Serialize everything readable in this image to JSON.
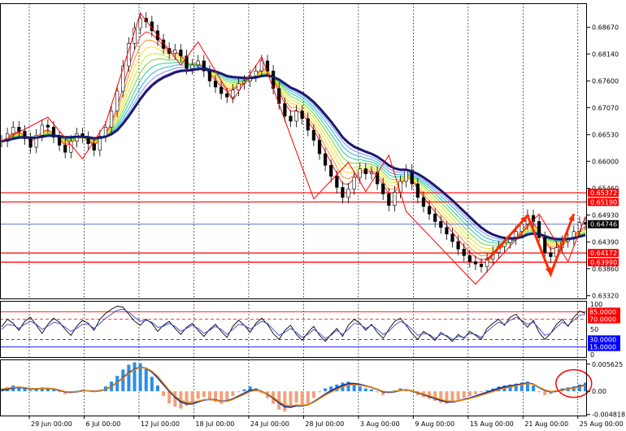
{
  "chart_data": [
    {
      "type": "line",
      "panel": "price",
      "x_labels": [
        "29 Jun 00:00",
        "6 Jul 00:00",
        "12 Jul 00:00",
        "18 Jul 00:00",
        "24 Jul 00:00",
        "28 Jul 00:00",
        "3 Aug 00:00",
        "9 Aug 00:00",
        "15 Aug 00:00",
        "21 Aug 00:00",
        "25 Aug 00:00"
      ],
      "y_ticks": [
        "0.68670",
        "0.68140",
        "0.67600",
        "0.67070",
        "0.66530",
        "0.66000",
        "0.65460",
        "0.64930",
        "0.64390",
        "0.63860",
        "0.63320"
      ],
      "ylim": [
        0.6325,
        0.6915
      ],
      "current_price": {
        "label": "0.64746",
        "value": 0.64746,
        "color": "#4a63c8"
      },
      "levels": [
        {
          "label": "0.65372",
          "value": 0.65372,
          "color": "#ff0000"
        },
        {
          "label": "0.65190",
          "value": 0.6519,
          "color": "#ff0000"
        },
        {
          "label": "0.64172",
          "value": 0.64172,
          "color": "#ff0000"
        },
        {
          "label": "0.63990",
          "value": 0.6399,
          "color": "#ff0000"
        }
      ],
      "close_series": [
        0.664,
        0.6655,
        0.6668,
        0.666,
        0.6645,
        0.6628,
        0.6652,
        0.6672,
        0.6668,
        0.6648,
        0.6632,
        0.6618,
        0.664,
        0.6655,
        0.6648,
        0.6635,
        0.6622,
        0.665,
        0.6668,
        0.67,
        0.674,
        0.679,
        0.6835,
        0.6865,
        0.6885,
        0.6878,
        0.686,
        0.6842,
        0.6825,
        0.6815,
        0.6822,
        0.681,
        0.6785,
        0.6792,
        0.68,
        0.678,
        0.676,
        0.6748,
        0.6735,
        0.6728,
        0.6742,
        0.6755,
        0.676,
        0.677,
        0.678,
        0.68,
        0.678,
        0.6745,
        0.6715,
        0.669,
        0.668,
        0.67,
        0.6685,
        0.6662,
        0.6642,
        0.6615,
        0.6592,
        0.657,
        0.6548,
        0.6528,
        0.6545,
        0.6568,
        0.6585,
        0.6575,
        0.6578,
        0.6555,
        0.6535,
        0.6512,
        0.6538,
        0.656,
        0.6582,
        0.6555,
        0.6528,
        0.651,
        0.6495,
        0.648,
        0.6468,
        0.6455,
        0.644,
        0.6425,
        0.6412,
        0.64,
        0.6395,
        0.639,
        0.6405,
        0.6418,
        0.643,
        0.6438,
        0.6445,
        0.646,
        0.6475,
        0.6492,
        0.648,
        0.6448,
        0.6418,
        0.641,
        0.6428,
        0.644,
        0.6445,
        0.646,
        0.6478,
        0.6475
      ],
      "ma_series": [
        0.664,
        0.6642,
        0.6645,
        0.6647,
        0.6648,
        0.6647,
        0.6647,
        0.6649,
        0.6651,
        0.6651,
        0.665,
        0.6648,
        0.6648,
        0.6649,
        0.6649,
        0.6648,
        0.6646,
        0.6647,
        0.6649,
        0.6654,
        0.6662,
        0.6675,
        0.669,
        0.6707,
        0.6724,
        0.6739,
        0.6751,
        0.676,
        0.6767,
        0.6772,
        0.6777,
        0.678,
        0.6781,
        0.6782,
        0.6784,
        0.6784,
        0.6782,
        0.6779,
        0.6775,
        0.677,
        0.6768,
        0.6767,
        0.6766,
        0.6766,
        0.6767,
        0.677,
        0.6771,
        0.6768,
        0.6763,
        0.6755,
        0.6747,
        0.6742,
        0.6736,
        0.6728,
        0.6718,
        0.6706,
        0.6693,
        0.6679,
        0.6664,
        0.6648,
        0.6637,
        0.6629,
        0.6624,
        0.6619,
        0.6615,
        0.6609,
        0.6601,
        0.6592,
        0.6586,
        0.6583,
        0.6583,
        0.658,
        0.6575,
        0.6568,
        0.656,
        0.6551,
        0.6542,
        0.6532,
        0.6522,
        0.6511,
        0.65,
        0.6489,
        0.6478,
        0.6468,
        0.646,
        0.6454,
        0.645,
        0.6447,
        0.6446,
        0.6447,
        0.6449,
        0.6454,
        0.6456,
        0.6455,
        0.6451,
        0.6447,
        0.6445,
        0.6445,
        0.6445,
        0.6447,
        0.645,
        0.6453
      ]
    },
    {
      "type": "line",
      "panel": "oscillator",
      "y_ticks": [
        "100",
        "70",
        "50",
        "30",
        "0"
      ],
      "ylim": [
        0,
        100
      ],
      "levels": [
        {
          "label": "85.0000",
          "value": 85,
          "color": "#ff0000"
        },
        {
          "label": "70.0000",
          "value": 70,
          "color": "#ff0000"
        },
        {
          "label": "30.0000",
          "value": 30,
          "color": "#0000ff"
        },
        {
          "label": "15.0000",
          "value": 15,
          "color": "#0000ff"
        }
      ],
      "series": [
        {
          "values": [
            55,
            70,
            62,
            48,
            66,
            74,
            58,
            42,
            60,
            72,
            64,
            50,
            38,
            56,
            68,
            62,
            48,
            70,
            82,
            90,
            96,
            94,
            80,
            66,
            58,
            70,
            62,
            46,
            58,
            66,
            52,
            40,
            54,
            62,
            48,
            36,
            50,
            60,
            46,
            34,
            56,
            68,
            58,
            44,
            62,
            72,
            60,
            42,
            30,
            48,
            58,
            40,
            28,
            44,
            56,
            38,
            26,
            40,
            52,
            36,
            58,
            70,
            62,
            48,
            60,
            44,
            32,
            50,
            66,
            72,
            58,
            42,
            30,
            46,
            38,
            28,
            44,
            36,
            26,
            40,
            32,
            46,
            38,
            30,
            52,
            62,
            70,
            58,
            74,
            80,
            66,
            54,
            68,
            44,
            30,
            42,
            60,
            70,
            56,
            74,
            86,
            82
          ]
        },
        {
          "values": [
            50,
            60,
            58,
            52,
            60,
            66,
            60,
            50,
            56,
            64,
            62,
            54,
            46,
            52,
            60,
            60,
            52,
            62,
            72,
            80,
            88,
            90,
            84,
            74,
            66,
            68,
            64,
            54,
            56,
            62,
            56,
            46,
            52,
            58,
            52,
            42,
            48,
            56,
            50,
            40,
            50,
            60,
            58,
            50,
            58,
            66,
            62,
            50,
            38,
            44,
            52,
            44,
            34,
            40,
            50,
            42,
            32,
            38,
            48,
            40,
            50,
            62,
            60,
            52,
            58,
            50,
            40,
            46,
            58,
            66,
            60,
            50,
            38,
            42,
            40,
            32,
            40,
            38,
            30,
            36,
            34,
            42,
            40,
            34,
            46,
            56,
            64,
            60,
            68,
            74,
            68,
            60,
            64,
            52,
            38,
            42,
            54,
            64,
            58,
            68,
            78,
            80
          ]
        }
      ]
    },
    {
      "type": "bar",
      "panel": "histogram",
      "y_ticks": [
        "0.005625",
        "0.00",
        "-0.004818"
      ],
      "ylim": [
        -0.0052,
        0.0066
      ],
      "values": [
        0.0005,
        0.0008,
        0.0012,
        0.001,
        0.0006,
        0.0002,
        0.0004,
        0.0008,
        0.0007,
        0.0003,
        -0.0002,
        -0.0006,
        -0.0004,
        0.0001,
        0.0003,
        0.0001,
        -0.0002,
        0.0003,
        0.001,
        0.002,
        0.0032,
        0.0045,
        0.0055,
        0.006,
        0.0058,
        0.0046,
        0.003,
        0.0012,
        -0.001,
        -0.0025,
        -0.0032,
        -0.0036,
        -0.003,
        -0.0022,
        -0.0016,
        -0.0012,
        -0.0016,
        -0.0022,
        -0.0026,
        -0.002,
        -0.001,
        -0.0002,
        0.0004,
        0.001,
        0.0006,
        -0.0004,
        -0.0014,
        -0.0026,
        -0.0038,
        -0.0042,
        -0.0034,
        -0.0024,
        -0.003,
        -0.0026,
        -0.0014,
        -0.0002,
        0.0006,
        0.001,
        0.0014,
        0.0018,
        0.002,
        0.0016,
        0.001,
        0.0006,
        0.0004,
        -0.0002,
        -0.0008,
        -0.0004,
        0.0002,
        0.0006,
        0.0004,
        -0.0002,
        -0.0008,
        -0.0012,
        -0.0016,
        -0.002,
        -0.0024,
        -0.0026,
        -0.0022,
        -0.0018,
        -0.0014,
        -0.001,
        -0.0006,
        -0.0002,
        0.0002,
        0.0006,
        0.001,
        0.0012,
        0.0014,
        0.0016,
        0.0018,
        0.002,
        0.0012,
        -0.0002,
        -0.0008,
        -0.0006,
        0.0002,
        0.0006,
        0.0008,
        0.001,
        0.0014,
        0.0018
      ],
      "signal": [
        0.0002,
        0.0004,
        0.0007,
        0.0008,
        0.0007,
        0.0005,
        0.0005,
        0.0006,
        0.0006,
        0.0005,
        0.0002,
        -0.0001,
        -0.0002,
        -0.0001,
        0.0001,
        0.0001,
        0.0,
        0.0001,
        0.0004,
        0.001,
        0.0018,
        0.0028,
        0.0038,
        0.0046,
        0.005,
        0.0048,
        0.004,
        0.0028,
        0.0014,
        0.0,
        -0.0012,
        -0.0022,
        -0.0026,
        -0.0026,
        -0.0022,
        -0.0018,
        -0.0017,
        -0.0018,
        -0.0021,
        -0.002,
        -0.0016,
        -0.001,
        -0.0004,
        0.0002,
        0.0003,
        0.0,
        -0.0006,
        -0.0014,
        -0.0024,
        -0.0032,
        -0.0033,
        -0.003,
        -0.003,
        -0.0028,
        -0.0022,
        -0.0014,
        -0.0006,
        0.0001,
        0.0007,
        0.0012,
        0.0016,
        0.0016,
        0.0014,
        0.0011,
        0.0008,
        0.0004,
        -0.0001,
        -0.0002,
        -0.0001,
        0.0002,
        0.0003,
        0.0001,
        -0.0003,
        -0.0007,
        -0.0011,
        -0.0015,
        -0.0019,
        -0.0022,
        -0.0022,
        -0.002,
        -0.0017,
        -0.0014,
        -0.001,
        -0.0006,
        -0.0002,
        0.0002,
        0.0006,
        0.0009,
        0.0011,
        0.0013,
        0.0015,
        0.0017,
        0.0015,
        0.0008,
        0.0002,
        -0.0001,
        0.0,
        0.0003,
        0.0005,
        0.0007,
        0.001,
        0.0013
      ]
    }
  ]
}
